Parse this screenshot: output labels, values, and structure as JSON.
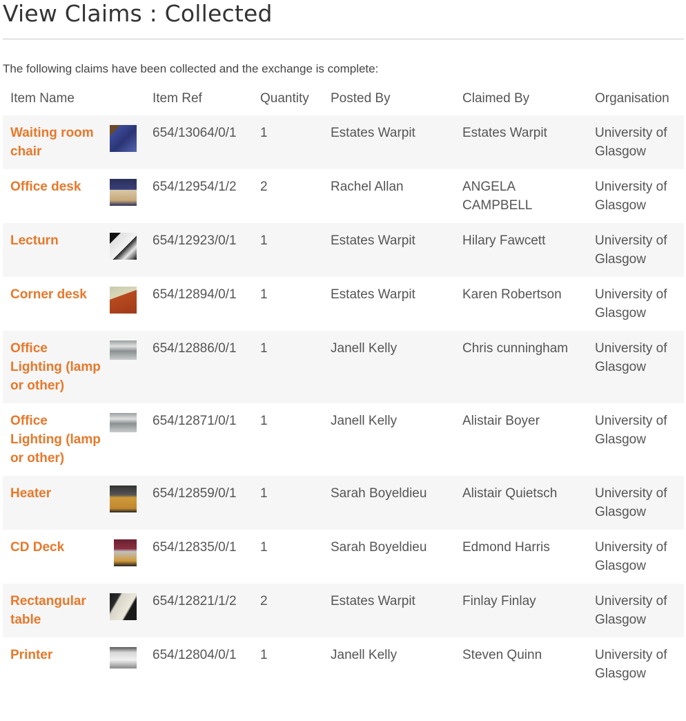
{
  "page": {
    "title": "View Claims : Collected",
    "intro": "The following claims have been collected and the exchange is complete:"
  },
  "table": {
    "headers": {
      "item_name": "Item Name",
      "item_ref": "Item Ref",
      "quantity": "Quantity",
      "posted_by": "Posted By",
      "claimed_by": "Claimed By",
      "organisation": "Organisation"
    },
    "rows": [
      {
        "name": "Waiting room chair",
        "thumb": "chair-photo",
        "ref": "654/13064/0/1",
        "qty": "1",
        "posted_by": "Estates Warpit",
        "claimed_by": "Estates Warpit",
        "org": "University of Glasgow"
      },
      {
        "name": "Office desk",
        "thumb": "desk-photo",
        "ref": "654/12954/1/2",
        "qty": "2",
        "posted_by": "Rachel Allan",
        "claimed_by": "ANGELA CAMPBELL",
        "org": "University of Glasgow"
      },
      {
        "name": "Lecturn",
        "thumb": "lectern-photo",
        "ref": "654/12923/0/1",
        "qty": "1",
        "posted_by": "Estates Warpit",
        "claimed_by": "Hilary Fawcett",
        "org": "University of Glasgow"
      },
      {
        "name": "Corner desk",
        "thumb": "corner-desk-photo",
        "ref": "654/12894/0/1",
        "qty": "1",
        "posted_by": "Estates Warpit",
        "claimed_by": "Karen Robertson",
        "org": "University of Glasgow"
      },
      {
        "name": "Office Lighting (lamp or other)",
        "thumb": "lamp-photo",
        "ref": "654/12886/0/1",
        "qty": "1",
        "posted_by": "Janell Kelly",
        "claimed_by": "Chris cunningham",
        "org": "University of Glasgow"
      },
      {
        "name": "Office Lighting (lamp or other)",
        "thumb": "lamp-photo",
        "ref": "654/12871/0/1",
        "qty": "1",
        "posted_by": "Janell Kelly",
        "claimed_by": "Alistair Boyer",
        "org": "University of Glasgow"
      },
      {
        "name": "Heater",
        "thumb": "heater-photo",
        "ref": "654/12859/0/1",
        "qty": "1",
        "posted_by": "Sarah Boyeldieu",
        "claimed_by": "Alistair Quietsch",
        "org": "University of Glasgow"
      },
      {
        "name": "CD Deck",
        "thumb": "cd-deck-photo",
        "ref": "654/12835/0/1",
        "qty": "1",
        "posted_by": "Sarah Boyeldieu",
        "claimed_by": "Edmond Harris",
        "org": "University of Glasgow"
      },
      {
        "name": "Rectangular table",
        "thumb": "table-photo",
        "ref": "654/12821/1/2",
        "qty": "2",
        "posted_by": "Estates Warpit",
        "claimed_by": "Finlay Finlay",
        "org": "University of Glasgow"
      },
      {
        "name": "Printer",
        "thumb": "printer-photo",
        "ref": "654/12804/0/1",
        "qty": "1",
        "posted_by": "Janell Kelly",
        "claimed_by": "Steven Quinn",
        "org": "University of Glasgow"
      }
    ]
  },
  "colors": {
    "link": "#e8782a",
    "text": "#555555",
    "stripe": "#f6f6f6"
  }
}
